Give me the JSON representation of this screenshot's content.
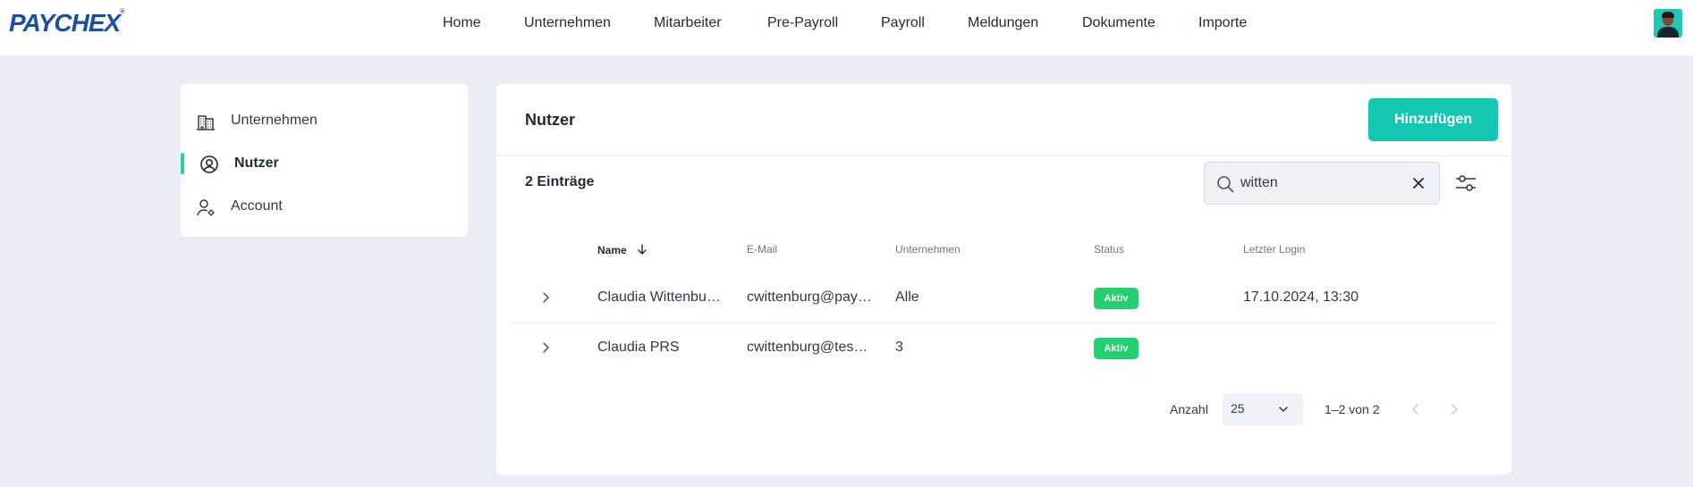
{
  "brand": {
    "logo_text": "PAYCHEX",
    "accent": "#14c7b3",
    "logo_color": "#1c4fa3",
    "active_status_color": "#22d06f"
  },
  "nav": {
    "items": [
      {
        "label": "Home"
      },
      {
        "label": "Unternehmen"
      },
      {
        "label": "Mitarbeiter"
      },
      {
        "label": "Pre-Payroll"
      },
      {
        "label": "Payroll"
      },
      {
        "label": "Meldungen"
      },
      {
        "label": "Dokumente"
      },
      {
        "label": "Importe"
      }
    ]
  },
  "sidebar": {
    "items": [
      {
        "label": "Unternehmen",
        "icon": "building-icon",
        "active": false
      },
      {
        "label": "Nutzer",
        "icon": "user-circle-icon",
        "active": true
      },
      {
        "label": "Account",
        "icon": "user-gear-icon",
        "active": false
      }
    ]
  },
  "main": {
    "title": "Nutzer",
    "add_button": "Hinzufügen",
    "entry_count": "2 Einträge",
    "search": {
      "value": "witten",
      "icon": "search-icon"
    },
    "table": {
      "columns": [
        "Name",
        "E-Mail",
        "Unternehmen",
        "Status",
        "Letzter Login"
      ],
      "sort_column": "Name",
      "sort_direction": "descending",
      "rows": [
        {
          "name": "Claudia Wittenbu…",
          "email": "cwittenburg@pay…",
          "company": "Alle",
          "status": "Aktiv",
          "last_login": "17.10.2024, 13:30"
        },
        {
          "name": "Claudia PRS",
          "email": "cwittenburg@tes…",
          "company": "3",
          "status": "Aktiv",
          "last_login": ""
        }
      ]
    },
    "pagination": {
      "per_page_label": "Anzahl",
      "per_page_value": "25",
      "range": "1–2 von 2"
    }
  }
}
